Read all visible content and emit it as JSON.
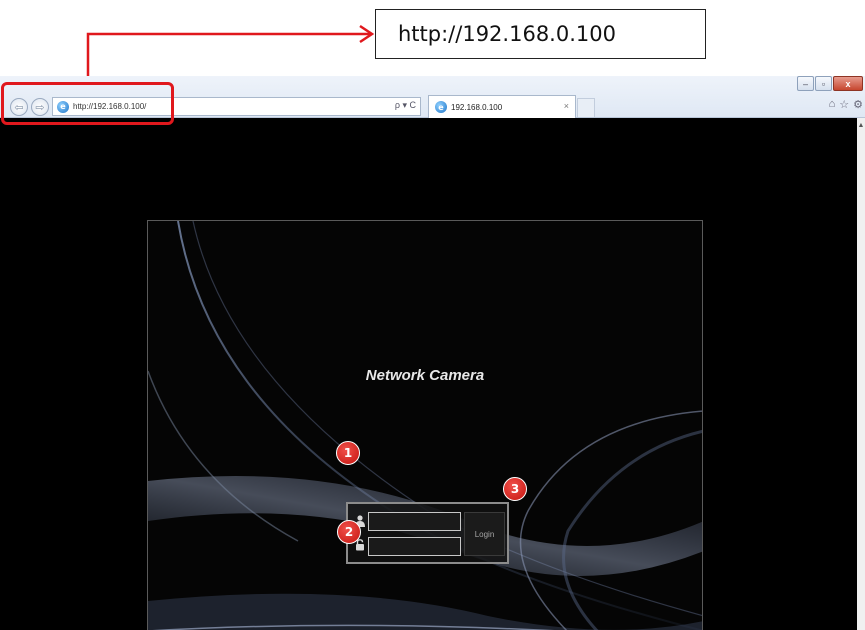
{
  "callout": {
    "url_text": "http://192.168.0.100",
    "arrow_color": "#e0181d"
  },
  "browser": {
    "address": "http://192.168.0.100/",
    "tab_title": "192.168.0.100",
    "tab_close": "×",
    "address_tools": "ρ ▾ C",
    "window_controls": [
      "–",
      "▫",
      "x"
    ],
    "right_icons": [
      "⌂",
      "☆",
      "⚙"
    ]
  },
  "page": {
    "title": "Network Camera",
    "username_value": "",
    "password_value": "",
    "login_label": "Login"
  },
  "badges": {
    "one": "1",
    "two": "2",
    "three": "3",
    "color": "#d0191a"
  },
  "icons": {
    "back": "back-arrow-icon",
    "forward": "forward-arrow-icon",
    "user": "user-icon",
    "lock": "lock-icon"
  }
}
